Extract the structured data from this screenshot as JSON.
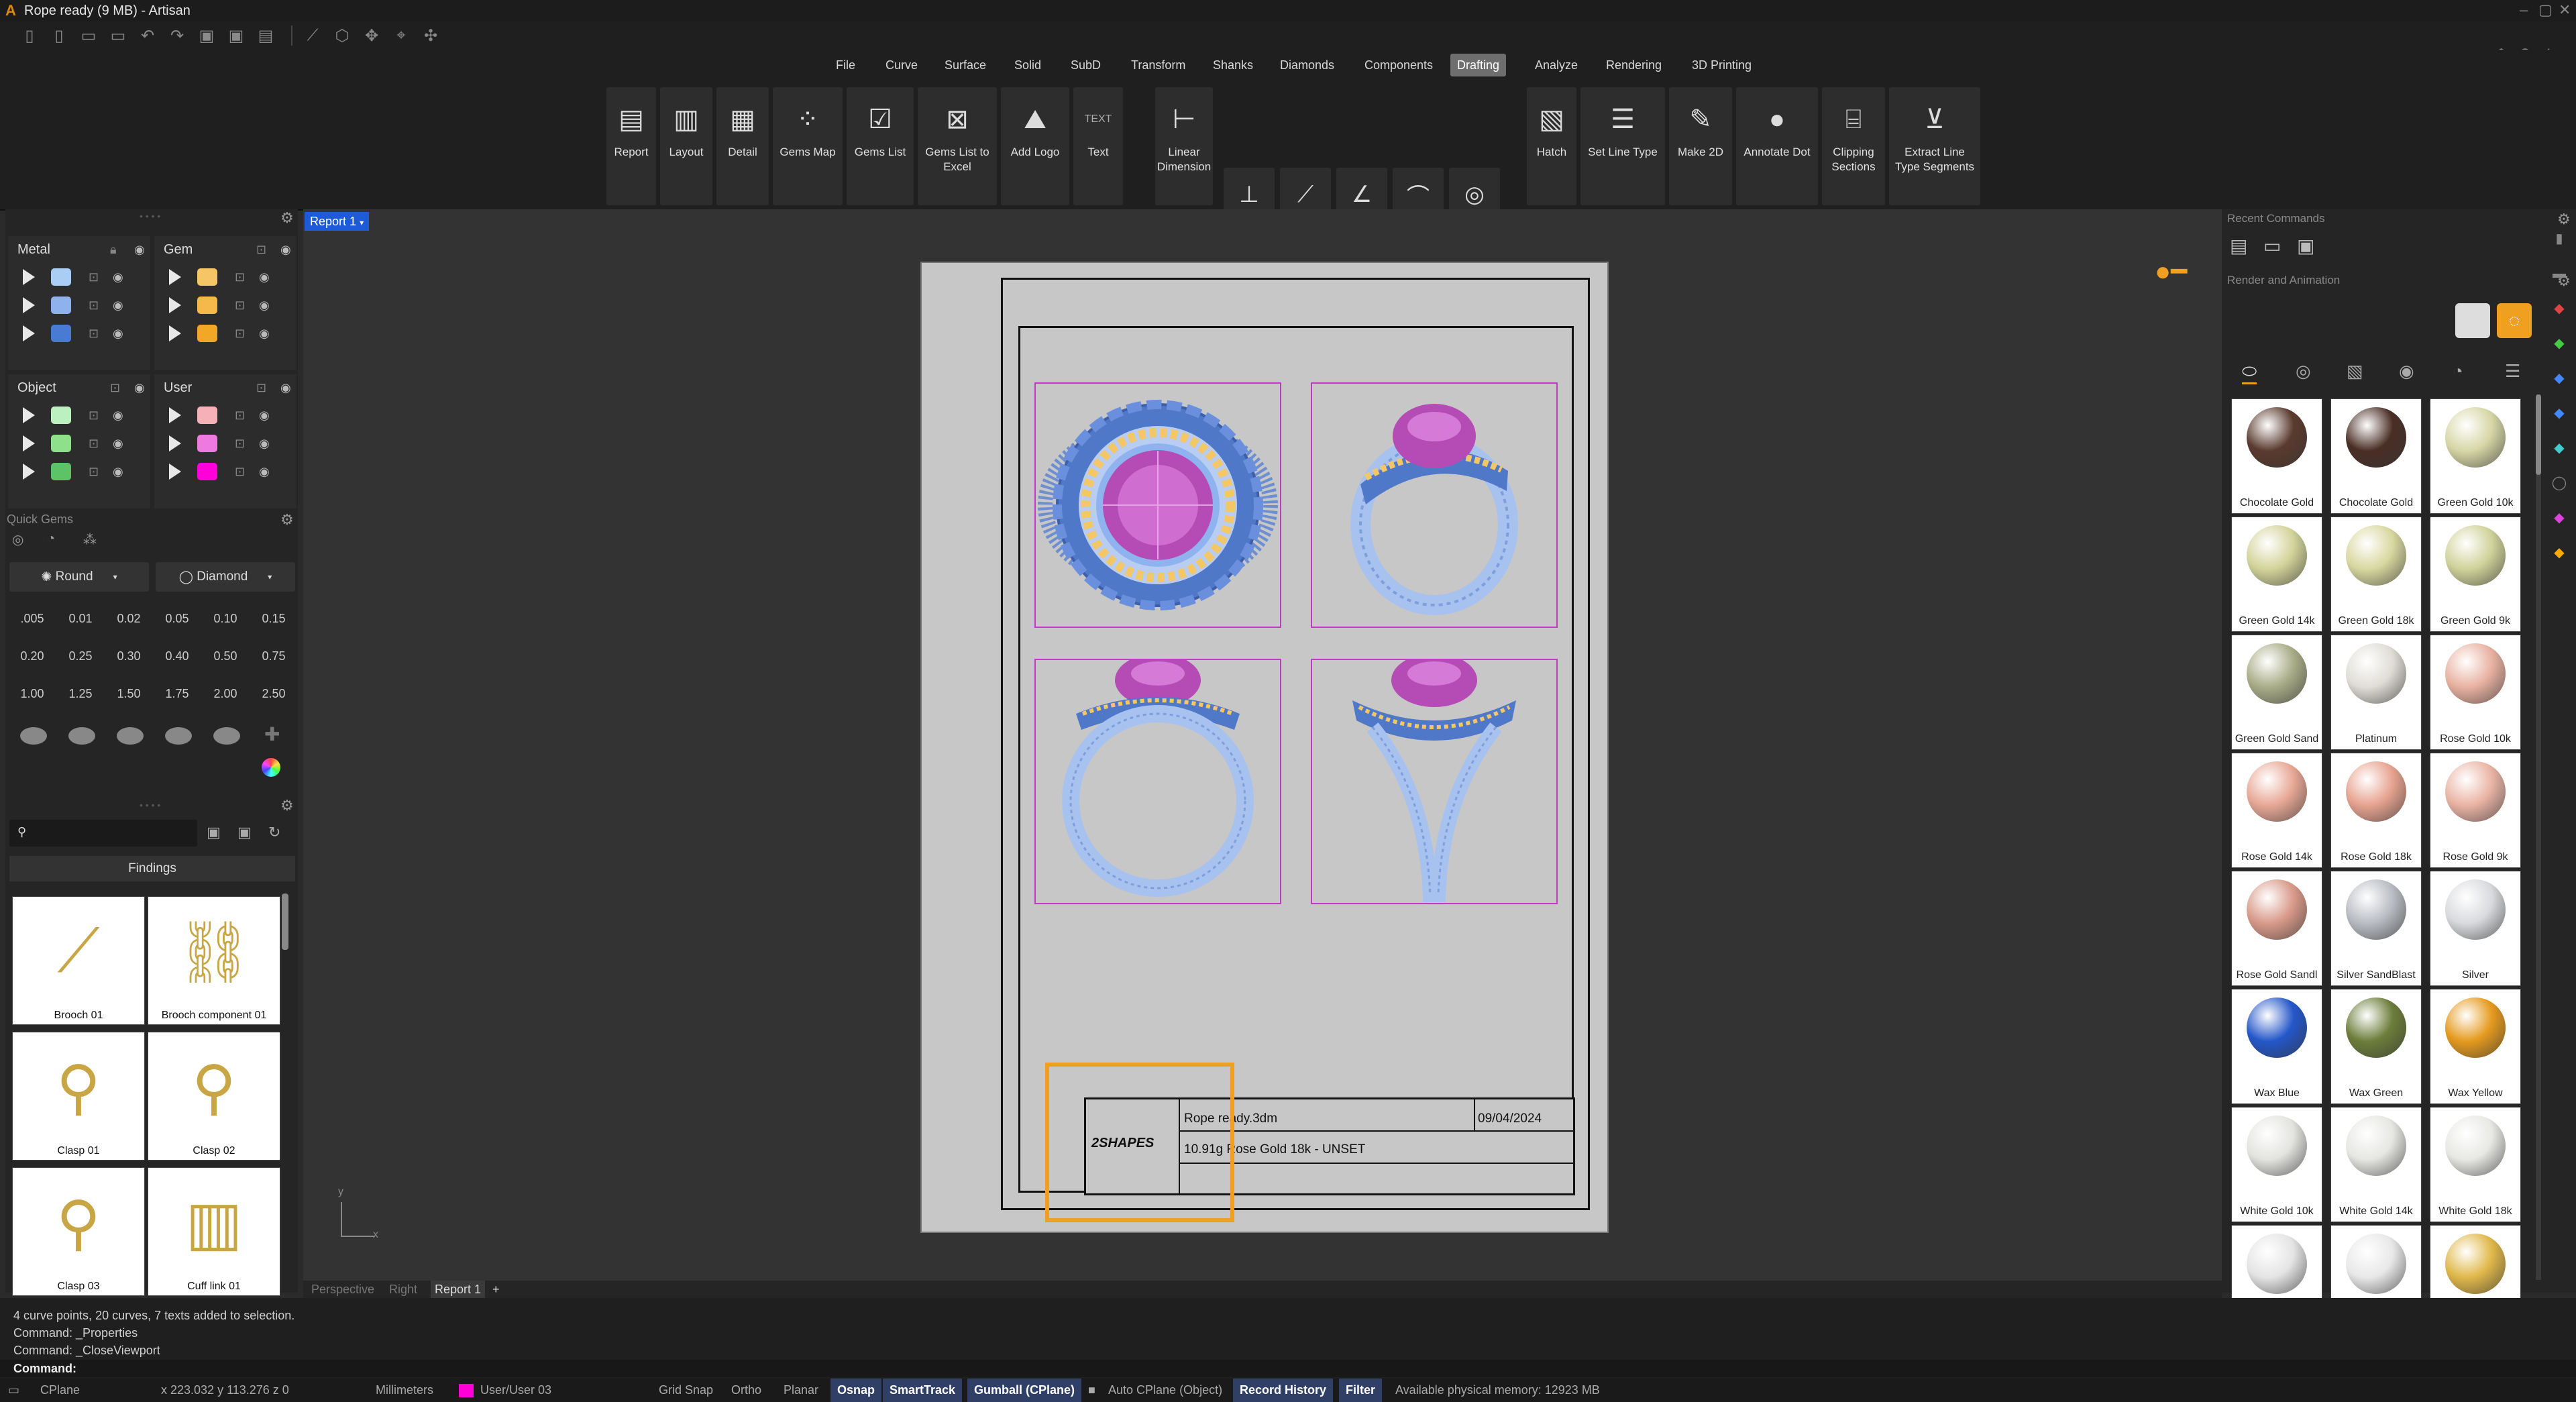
{
  "window": {
    "title": "Rope ready (9 MB) - Artisan"
  },
  "menu": [
    "File",
    "Curve",
    "Surface",
    "Solid",
    "SubD",
    "Transform",
    "Shanks",
    "Diamonds",
    "Components",
    "Drafting",
    "Analyze",
    "Rendering",
    "3D Printing"
  ],
  "menu_active": "Drafting",
  "ribbon": {
    "report": "Report",
    "layout": "Layout",
    "detail": "Detail",
    "gems_map": "Gems Map",
    "gems_list": "Gems List",
    "gems_list_excel_1": "Gems List to",
    "gems_list_excel_2": "Excel",
    "add_logo": "Add Logo",
    "text": "Text",
    "text_icon": "TEXT",
    "linear_dim_1": "Linear",
    "linear_dim_2": "Dimension",
    "hatch": "Hatch",
    "set_line_type": "Set Line Type",
    "make_2d": "Make 2D",
    "annotate_dot": "Annotate Dot",
    "clipping_1": "Clipping",
    "clipping_2": "Sections",
    "extract_1": "Extract Line",
    "extract_2": "Type Segments"
  },
  "layers": {
    "metal": "Metal",
    "gem": "Gem",
    "object": "Object",
    "user": "User",
    "metal_colors": [
      "#a9cdf5",
      "#8fb2ee",
      "#4a7bd4"
    ],
    "gem_colors": [
      "#f5c566",
      "#f5b84a",
      "#f2a826"
    ],
    "object_colors": [
      "#bdf0c0",
      "#8fe08a",
      "#5cc466"
    ],
    "user_colors": [
      "#f5b0b8",
      "#ef7adf",
      "#ff00d8"
    ]
  },
  "quick_gems": {
    "title": "Quick Gems",
    "cut": "Round",
    "material": "Diamond",
    "sizes": [
      ".005",
      "0.01",
      "0.02",
      "0.05",
      "0.10",
      "0.15",
      "0.20",
      "0.25",
      "0.30",
      "0.40",
      "0.50",
      "0.75",
      "1.00",
      "1.25",
      "1.50",
      "1.75",
      "2.00",
      "2.50"
    ]
  },
  "findings": {
    "category": "Findings",
    "items": [
      "Brooch 01",
      "Brooch component 01",
      "Clasp 01",
      "Clasp 02",
      "Clasp 03",
      "Cuff link 01"
    ]
  },
  "viewport": {
    "tab": "Report 1",
    "tabs": [
      "Perspective",
      "Right",
      "Report 1"
    ],
    "axis_y": "y",
    "axis_x": "x"
  },
  "title_block": {
    "logo": "2SHAPES",
    "filename": "Rope ready.3dm",
    "date": "09/04/2024",
    "material": "10.91g Rose Gold 18k - UNSET"
  },
  "right_panel": {
    "recent_commands": "Recent Commands",
    "render_animation": "Render and Animation",
    "materials": [
      {
        "name": "Chocolate Gold",
        "color": "#5a3a2e"
      },
      {
        "name": "Chocolate Gold",
        "color": "#4a2e25"
      },
      {
        "name": "Green Gold 10k",
        "color": "#d6d7a6"
      },
      {
        "name": "Green Gold 14k",
        "color": "#d3d49a"
      },
      {
        "name": "Green Gold 18k",
        "color": "#d8d8a0"
      },
      {
        "name": "Green Gold 9k",
        "color": "#d0d39a"
      },
      {
        "name": "Green Gold Sand",
        "color": "#a9ad88"
      },
      {
        "name": "Platinum",
        "color": "#e0ddd6"
      },
      {
        "name": "Rose Gold 10k",
        "color": "#e9b2a2"
      },
      {
        "name": "Rose Gold 14k",
        "color": "#e8a896"
      },
      {
        "name": "Rose Gold 18k",
        "color": "#e7a390"
      },
      {
        "name": "Rose Gold 9k",
        "color": "#eab4a5"
      },
      {
        "name": "Rose Gold Sandl",
        "color": "#d99a8a"
      },
      {
        "name": "Silver SandBlast",
        "color": "#b9bcc2"
      },
      {
        "name": "Silver",
        "color": "#d9dadd"
      },
      {
        "name": "Wax Blue",
        "color": "#2457c9"
      },
      {
        "name": "Wax Green",
        "color": "#6d7d3a"
      },
      {
        "name": "Wax Yellow",
        "color": "#e59a1e"
      },
      {
        "name": "White Gold 10k",
        "color": "#e3e3e0"
      },
      {
        "name": "White Gold 14k",
        "color": "#e6e6e3"
      },
      {
        "name": "White Gold 18k",
        "color": "#e8e8e5"
      },
      {
        "name": "",
        "color": "#e4e4e4"
      },
      {
        "name": "",
        "color": "#e8e8e8"
      },
      {
        "name": "",
        "color": "#e0b84a"
      }
    ]
  },
  "command": {
    "history": [
      "4 curve points, 20 curves, 7 texts added to selection.",
      "Command: _Properties",
      "Command: _CloseViewport"
    ],
    "prompt": "Command:"
  },
  "status": {
    "cplane": "CPlane",
    "coords": "x 223.032  y 113.276  z 0",
    "units": "Millimeters",
    "layer": "User/User 03",
    "layer_color": "#ff00d8",
    "grid_snap": "Grid Snap",
    "ortho": "Ortho",
    "planar": "Planar",
    "osnap": "Osnap",
    "smarttrack": "SmartTrack",
    "gumball": "Gumball (CPlane)",
    "auto_cplane": "Auto CPlane (Object)",
    "record_history": "Record History",
    "filter": "Filter",
    "memory": "Available physical memory: 12923 MB"
  }
}
